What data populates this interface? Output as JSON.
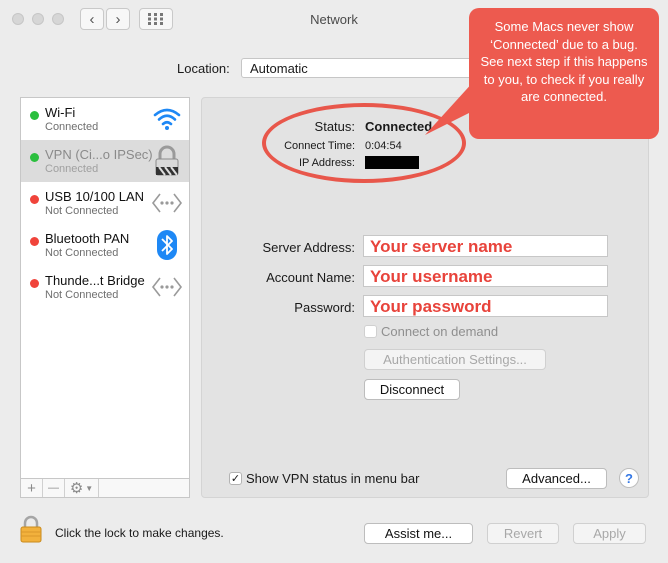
{
  "window": {
    "title": "Network"
  },
  "location": {
    "label": "Location:",
    "value": "Automatic"
  },
  "services": [
    {
      "name": "Wi-Fi",
      "status": "Connected",
      "dot_color": "#2bbf3e",
      "icon": "wifi-icon",
      "selected": false
    },
    {
      "name": "VPN (Ci...o IPSec)",
      "status": "Connected",
      "dot_color": "#2bbf3e",
      "icon": "lock-icon",
      "selected": true
    },
    {
      "name": "USB 10/100 LAN",
      "status": "Not Connected",
      "dot_color": "#f0443b",
      "icon": "ethernet-icon",
      "selected": false
    },
    {
      "name": "Bluetooth PAN",
      "status": "Not Connected",
      "dot_color": "#f0443b",
      "icon": "bluetooth-icon",
      "selected": false
    },
    {
      "name": "Thunde...t Bridge",
      "status": "Not Connected",
      "dot_color": "#f0443b",
      "icon": "ethernet-icon",
      "selected": false
    }
  ],
  "sidebar_controls": {
    "add": "+",
    "remove": "—",
    "gear": "gear-icon"
  },
  "status": {
    "status_label": "Status:",
    "status_value": "Connected",
    "time_label": "Connect Time:",
    "time_value": "0:04:54",
    "ip_label": "IP Address:",
    "ip_value": ""
  },
  "form": {
    "server_label": "Server Address:",
    "server_value": "Your server name",
    "account_label": "Account Name:",
    "account_value": "Your username",
    "password_label": "Password:",
    "password_value": "Your password",
    "connect_on_demand": "Connect on demand",
    "auth_button": "Authentication Settings...",
    "disconnect_button": "Disconnect"
  },
  "bottom": {
    "show_vpn_status": "Show VPN status in menu bar",
    "advanced_button": "Advanced...",
    "help": "?",
    "lock_text": "Click the lock to make changes.",
    "assist_button": "Assist me...",
    "revert_button": "Revert",
    "apply_button": "Apply"
  },
  "annotation": {
    "callout": "Some Macs never show ‘Connected’ due to a bug. See next step if this happens to you, to check if you really are connected."
  },
  "colors": {
    "annotation": "#ed5a4f",
    "connected": "#2bbf3e",
    "not_connected": "#f0443b",
    "bluetooth": "#1e88f5"
  }
}
